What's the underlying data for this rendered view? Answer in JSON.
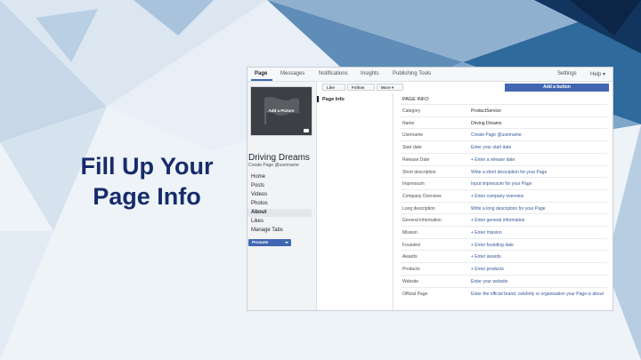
{
  "headline": {
    "line1": "Fill Up Your",
    "line2": "Page Info"
  },
  "topbar": {
    "tabs": [
      "Page",
      "Messages",
      "Notifications",
      "Insights",
      "Publishing Tools"
    ],
    "right": [
      "Settings",
      "Help ▾"
    ]
  },
  "sidebar": {
    "add_picture": "Add a Picture",
    "page_name": "Driving Dreams",
    "page_handle": "Create Page @username",
    "items": [
      "Home",
      "Posts",
      "Videos",
      "Photos",
      "About",
      "Likes",
      "Manage Tabs"
    ],
    "active_item": "About",
    "promote_label": "Promote"
  },
  "actions": {
    "like": "Like",
    "follow": "Follow",
    "more": "More ▾",
    "add_button": "Add a button"
  },
  "middle": {
    "label": "Page Info"
  },
  "page_info": {
    "header": "PAGE INFO",
    "rows": [
      {
        "key": "Category",
        "value": "ProductService"
      },
      {
        "key": "Name",
        "value": "Driving Dreams"
      },
      {
        "key": "Username",
        "value": "Create Page @username"
      },
      {
        "key": "Start date",
        "value": "Enter your start date"
      },
      {
        "key": "Release Date",
        "value": "+ Enter a release date"
      },
      {
        "key": "Short description",
        "value": "Write a short description for your Page"
      },
      {
        "key": "Impressum",
        "value": "Input impressum for your Page"
      },
      {
        "key": "Company Overview",
        "value": "+ Enter company overview"
      },
      {
        "key": "Long description",
        "value": "Write a long description for your Page"
      },
      {
        "key": "General information",
        "value": "+ Enter general information"
      },
      {
        "key": "Mission",
        "value": "+ Enter mission"
      },
      {
        "key": "Founded",
        "value": "+ Enter founding date"
      },
      {
        "key": "Awards",
        "value": "+ Enter awards"
      },
      {
        "key": "Products",
        "value": "+ Enter products"
      },
      {
        "key": "Website",
        "value": "Enter your website"
      },
      {
        "key": "Official Page",
        "value": "Enter the official brand, celebrity or organisation your Page is about"
      }
    ]
  },
  "colors": {
    "headline": "#162b6b",
    "facebook_blue": "#4267b2",
    "link": "#365899",
    "background_triangles": [
      "#7fa7c9",
      "#2f6a9c",
      "#12355f"
    ]
  }
}
